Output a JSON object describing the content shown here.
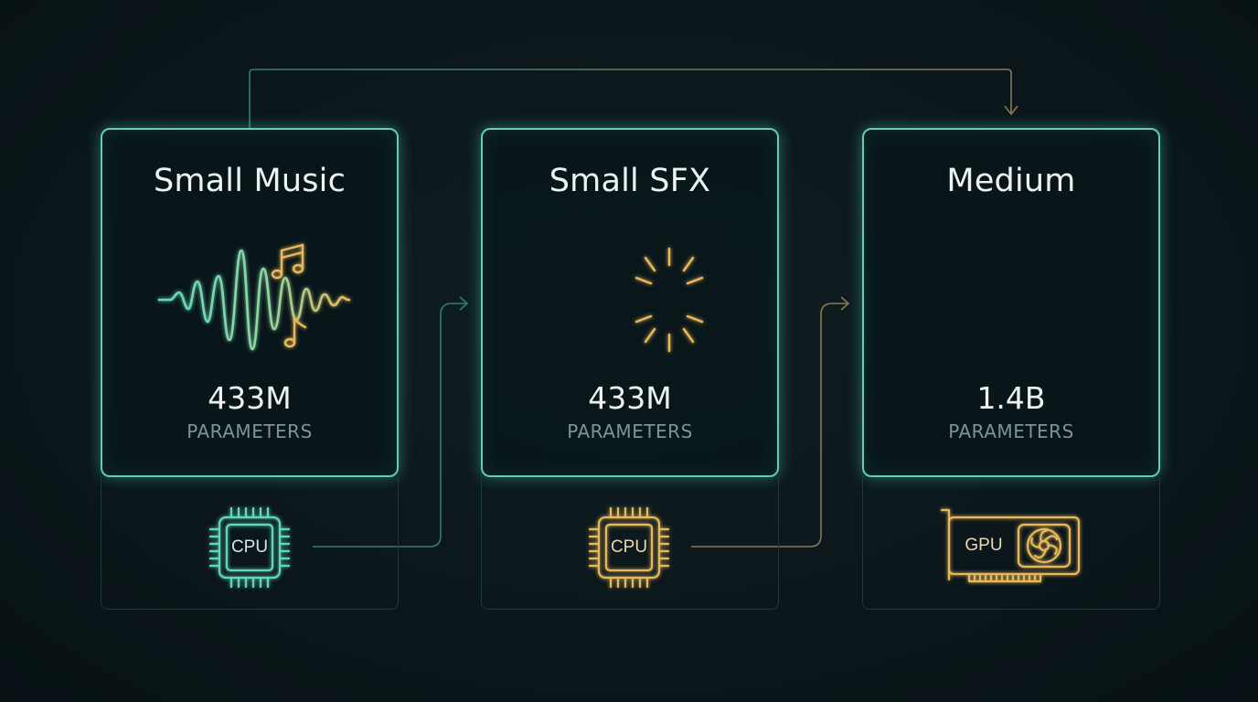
{
  "colors": {
    "background": "#0b171b",
    "teal": "#5fd8bb",
    "amber": "#e8b85a",
    "line_teal": "#2f7d74",
    "line_amber": "#8a7a4e"
  },
  "models": [
    {
      "title": "Small Music",
      "param_value": "433M",
      "param_label": "PARAMETERS",
      "hardware": {
        "label": "CPU",
        "icon": "cpu-chip-icon",
        "color": "#5fd8bb"
      },
      "decoration_icon": "music-note-icon"
    },
    {
      "title": "Small SFX",
      "param_value": "433M",
      "param_label": "PARAMETERS",
      "hardware": {
        "label": "CPU",
        "icon": "cpu-chip-icon",
        "color": "#e8b85a"
      },
      "decoration_icon": "burst-icon"
    },
    {
      "title": "Medium",
      "param_value": "1.4B",
      "param_label": "PARAMETERS",
      "hardware": {
        "label": "GPU",
        "icon": "gpu-card-icon",
        "color": "#e8b85a"
      },
      "decoration_icon": "waveform-icon"
    }
  ]
}
